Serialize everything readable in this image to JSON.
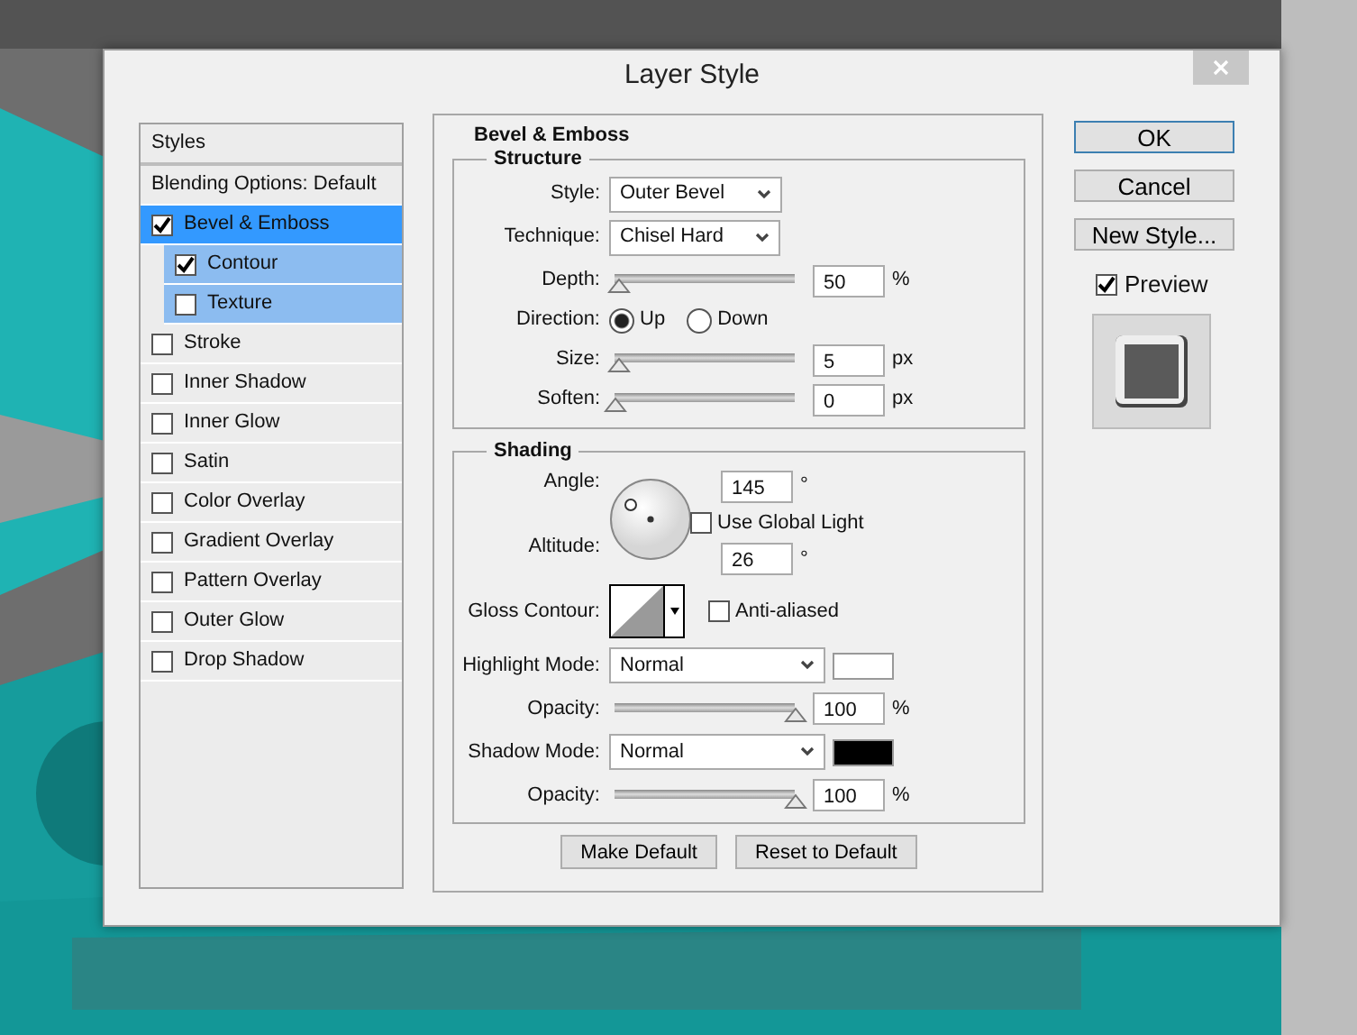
{
  "window": {
    "title": "Layer Style"
  },
  "styles_list": {
    "header": "Styles",
    "items": [
      {
        "label": "Blending Options: Default",
        "kind": "plain",
        "selected": false
      },
      {
        "label": "Bevel & Emboss",
        "kind": "check",
        "checked": true,
        "selected": true,
        "children": [
          {
            "label": "Contour",
            "checked": true
          },
          {
            "label": "Texture",
            "checked": false
          }
        ]
      },
      {
        "label": "Stroke",
        "kind": "check",
        "checked": false,
        "selected": false
      },
      {
        "label": "Inner Shadow",
        "kind": "check",
        "checked": false,
        "selected": false
      },
      {
        "label": "Inner Glow",
        "kind": "check",
        "checked": false,
        "selected": false
      },
      {
        "label": "Satin",
        "kind": "check",
        "checked": false,
        "selected": false
      },
      {
        "label": "Color Overlay",
        "kind": "check",
        "checked": false,
        "selected": false
      },
      {
        "label": "Gradient Overlay",
        "kind": "check",
        "checked": false,
        "selected": false
      },
      {
        "label": "Pattern Overlay",
        "kind": "check",
        "checked": false,
        "selected": false
      },
      {
        "label": "Outer Glow",
        "kind": "check",
        "checked": false,
        "selected": false
      },
      {
        "label": "Drop Shadow",
        "kind": "check",
        "checked": false,
        "selected": false
      }
    ]
  },
  "panel": {
    "title": "Bevel & Emboss",
    "groups": [
      {
        "title": "Structure",
        "rows": [
          {
            "kind": "select",
            "label": "Style:",
            "value": "Outer Bevel"
          },
          {
            "kind": "select",
            "label": "Technique:",
            "value": "Chisel Hard"
          },
          {
            "kind": "slider",
            "label": "Depth:",
            "level": 0.02,
            "value": "50",
            "unit": "%"
          },
          {
            "kind": "radio",
            "label": "Direction:",
            "options": [
              {
                "label": "Up",
                "selected": true
              },
              {
                "label": "Down",
                "selected": false
              }
            ]
          },
          {
            "kind": "slider",
            "label": "Size:",
            "level": 0.02,
            "value": "5",
            "unit": "px"
          },
          {
            "kind": "slider",
            "label": "Soften:",
            "level": 0,
            "value": "0",
            "unit": "px"
          }
        ]
      },
      {
        "title": "Shading",
        "rows": [
          {
            "kind": "angle",
            "label": "Angle:",
            "value": "145",
            "unit": "°",
            "global_light": {
              "label": "Use Global Light",
              "checked": false
            },
            "altitude_label": "Altitude:",
            "altitude": "26",
            "altitude_unit": "°"
          },
          {
            "kind": "contour",
            "label": "Gloss Contour:",
            "antialias": {
              "label": "Anti-aliased",
              "checked": false
            }
          },
          {
            "kind": "select",
            "label": "Highlight Mode:",
            "value": "Normal",
            "color": "#ffffff"
          },
          {
            "kind": "slider",
            "label": "Opacity:",
            "level": 1,
            "value": "100",
            "unit": "%"
          },
          {
            "kind": "select",
            "label": "Shadow Mode:",
            "value": "Normal",
            "color": "#000000"
          },
          {
            "kind": "slider",
            "label": "Opacity:",
            "level": 1,
            "value": "100",
            "unit": "%"
          }
        ]
      }
    ],
    "buttons": [
      "Make Default",
      "Reset to Default"
    ]
  },
  "actions": [
    {
      "label": "OK",
      "default": true
    },
    {
      "label": "Cancel",
      "default": false
    },
    {
      "label": "New Style...",
      "default": false
    }
  ],
  "preview": {
    "label": "Preview",
    "checked": true
  }
}
